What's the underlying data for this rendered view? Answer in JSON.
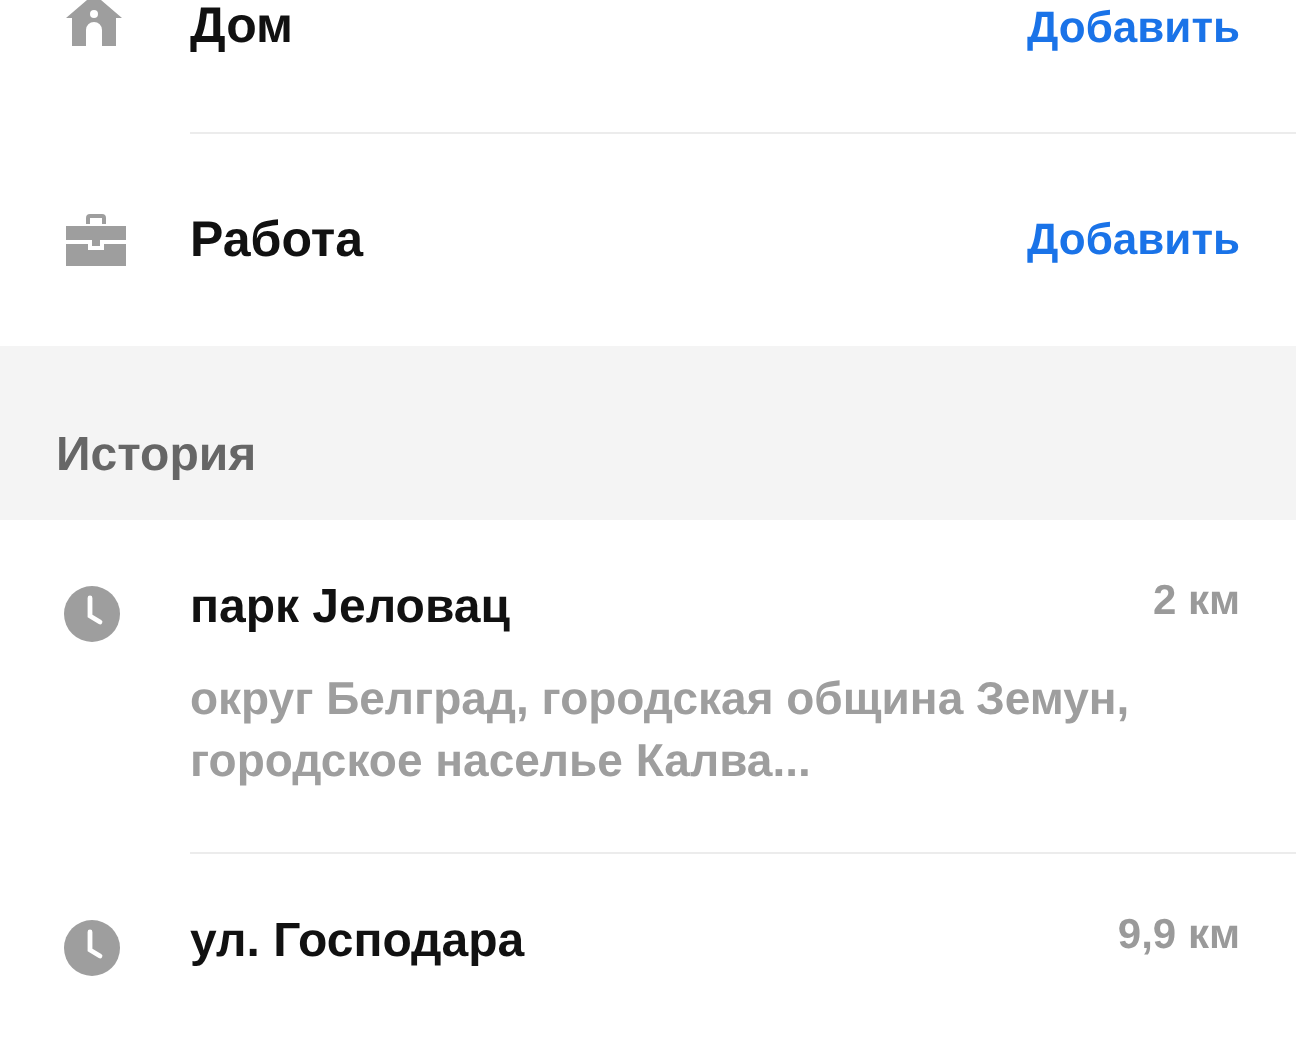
{
  "places": [
    {
      "kind": "home",
      "label": "Дом",
      "action": "Добавить"
    },
    {
      "kind": "work",
      "label": "Работа",
      "action": "Добавить"
    }
  ],
  "history": {
    "title": "История",
    "items": [
      {
        "title": "парк Јеловац",
        "distance": "2 км",
        "subtitle": "округ Белград, городская община Земун, городское населье Калва..."
      },
      {
        "title": "ул. Господара",
        "distance": "9,9 км"
      }
    ]
  }
}
